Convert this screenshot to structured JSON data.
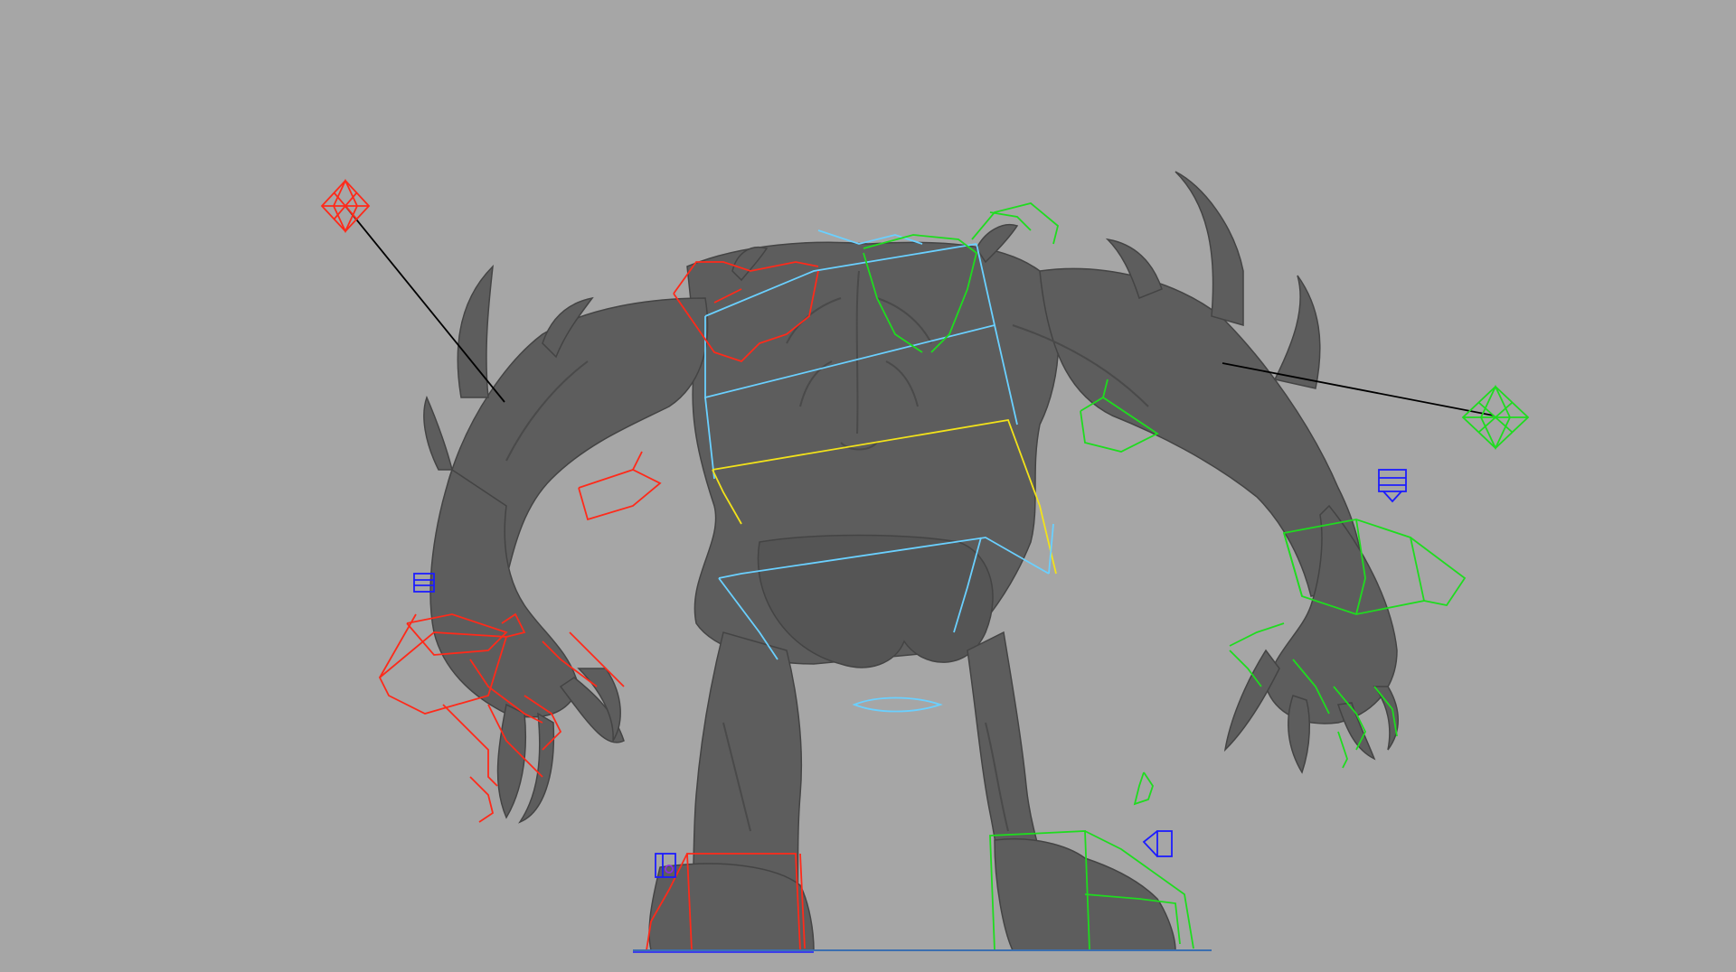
{
  "viewport": {
    "background": "#a6a6a6",
    "view": "perspective-back"
  },
  "model": {
    "type": "creature-mesh",
    "shading": "smooth-gray",
    "mesh_color": "#5d5d5d"
  },
  "rig_colors": {
    "left_side": "#ff2a1a",
    "right_side": "#1fdc1f",
    "center": "#6ad0ff",
    "cog": "#f2e21a",
    "pole_vector_line": "#000000",
    "ik_handle": "#1c1cff"
  },
  "controls": [
    {
      "name": "left-arm-pole-vector",
      "color_key": "left_side",
      "shape": "diamond-icon"
    },
    {
      "name": "right-arm-pole-vector",
      "color_key": "right_side",
      "shape": "diamond-icon"
    },
    {
      "name": "spine-chest",
      "color_key": "center",
      "shape": "box"
    },
    {
      "name": "cog-root",
      "color_key": "cog",
      "shape": "box"
    },
    {
      "name": "hip",
      "color_key": "center",
      "shape": "box"
    },
    {
      "name": "left-foot",
      "color_key": "left_side",
      "shape": "box"
    },
    {
      "name": "right-foot",
      "color_key": "right_side",
      "shape": "box"
    },
    {
      "name": "left-hand",
      "color_key": "left_side",
      "shape": "box"
    },
    {
      "name": "right-hand",
      "color_key": "right_side",
      "shape": "box"
    }
  ]
}
